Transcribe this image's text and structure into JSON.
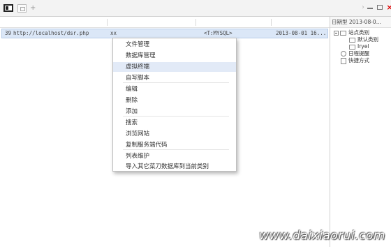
{
  "toolbar": {
    "add_tab": "+"
  },
  "window_controls": {
    "chevron": "›",
    "close": "×"
  },
  "shell_list": {
    "rows": [
      {
        "id": "39",
        "url": "http://localhost/dsr.php",
        "password": "xx",
        "type": "<T:MYSQL>",
        "date": "2013-08-01 16..."
      }
    ]
  },
  "right_panel": {
    "header": "日期型 2013-08-0...",
    "tree": {
      "root": "站点类别",
      "children": [
        "默认类别",
        "Iryel"
      ],
      "extra": [
        "日程提醒",
        "快捷方式"
      ]
    }
  },
  "context_menu": {
    "items": [
      "文件管理",
      "数据库管理",
      "虚拟终端",
      "自写脚本",
      "编辑",
      "删除",
      "添加",
      "搜索",
      "浏览网站",
      "复制服务端代码",
      "列表维护",
      "导入其它菜刀数据库到当前类别"
    ],
    "highlighted_index": 2
  },
  "watermark": "www.daixiaorui.com"
}
